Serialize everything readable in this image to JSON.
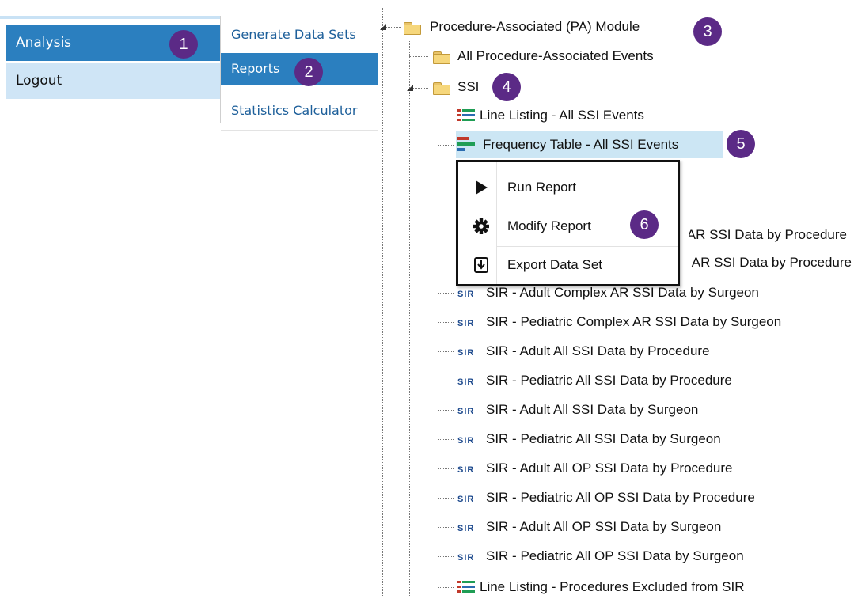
{
  "nav": {
    "items": [
      {
        "label": "Analysis"
      },
      {
        "label": "Logout"
      }
    ]
  },
  "submenu": {
    "items": [
      {
        "label": "Generate Data Sets"
      },
      {
        "label": "Reports"
      },
      {
        "label": "Statistics Calculator"
      }
    ]
  },
  "tree": {
    "root": {
      "label": "Procedure-Associated (PA) Module"
    },
    "all_events": {
      "label": "All Procedure-Associated Events"
    },
    "ssi": {
      "label": "SSI"
    },
    "reports": [
      {
        "icon": "line-listing-icon",
        "label": "Line Listing - All SSI Events"
      },
      {
        "icon": "frequency-table-icon",
        "label": "Frequency Table - All SSI Events"
      },
      {
        "icon": "sir-icon",
        "label": "SIR - Adult Complex AR SSI Data by Procedure"
      },
      {
        "icon": "sir-icon",
        "label": "SIR - Pediatric Complex AR SSI Data by Procedure"
      },
      {
        "icon": "sir-icon",
        "label": "SIR - Adult Complex AR SSI Data by Surgeon"
      },
      {
        "icon": "sir-icon",
        "label": "SIR - Pediatric Complex AR SSI Data by Surgeon"
      },
      {
        "icon": "sir-icon",
        "label": "SIR - Adult All SSI Data by Procedure"
      },
      {
        "icon": "sir-icon",
        "label": "SIR - Pediatric All SSI Data by Procedure"
      },
      {
        "icon": "sir-icon",
        "label": "SIR - Adult All SSI Data by Surgeon"
      },
      {
        "icon": "sir-icon",
        "label": "SIR - Pediatric All SSI Data by Surgeon"
      },
      {
        "icon": "sir-icon",
        "label": "SIR - Adult All OP SSI Data by Procedure"
      },
      {
        "icon": "sir-icon",
        "label": "SIR - Pediatric All OP SSI Data by Procedure"
      },
      {
        "icon": "sir-icon",
        "label": "SIR - Adult All OP SSI Data by Surgeon"
      },
      {
        "icon": "sir-icon",
        "label": "SIR - Pediatric All OP SSI Data by Surgeon"
      },
      {
        "icon": "line-listing-icon",
        "label": "Line Listing - Procedures Excluded from SIR"
      }
    ],
    "sir_icon_text": "SIR"
  },
  "context_menu": {
    "items": [
      {
        "icon": "play-icon",
        "label": "Run Report"
      },
      {
        "icon": "gear-icon",
        "label": "Modify Report"
      },
      {
        "icon": "export-icon",
        "label": "Export Data Set"
      }
    ]
  },
  "callouts": [
    "1",
    "2",
    "3",
    "4",
    "5",
    "6"
  ],
  "colors": {
    "nav_active": "#2b7fbf",
    "nav_inactive": "#cfe5f6",
    "link": "#1d5f9a",
    "callout": "#5b2a86",
    "tree_selected": "#cce6f4",
    "folder": "#f6d77c"
  }
}
